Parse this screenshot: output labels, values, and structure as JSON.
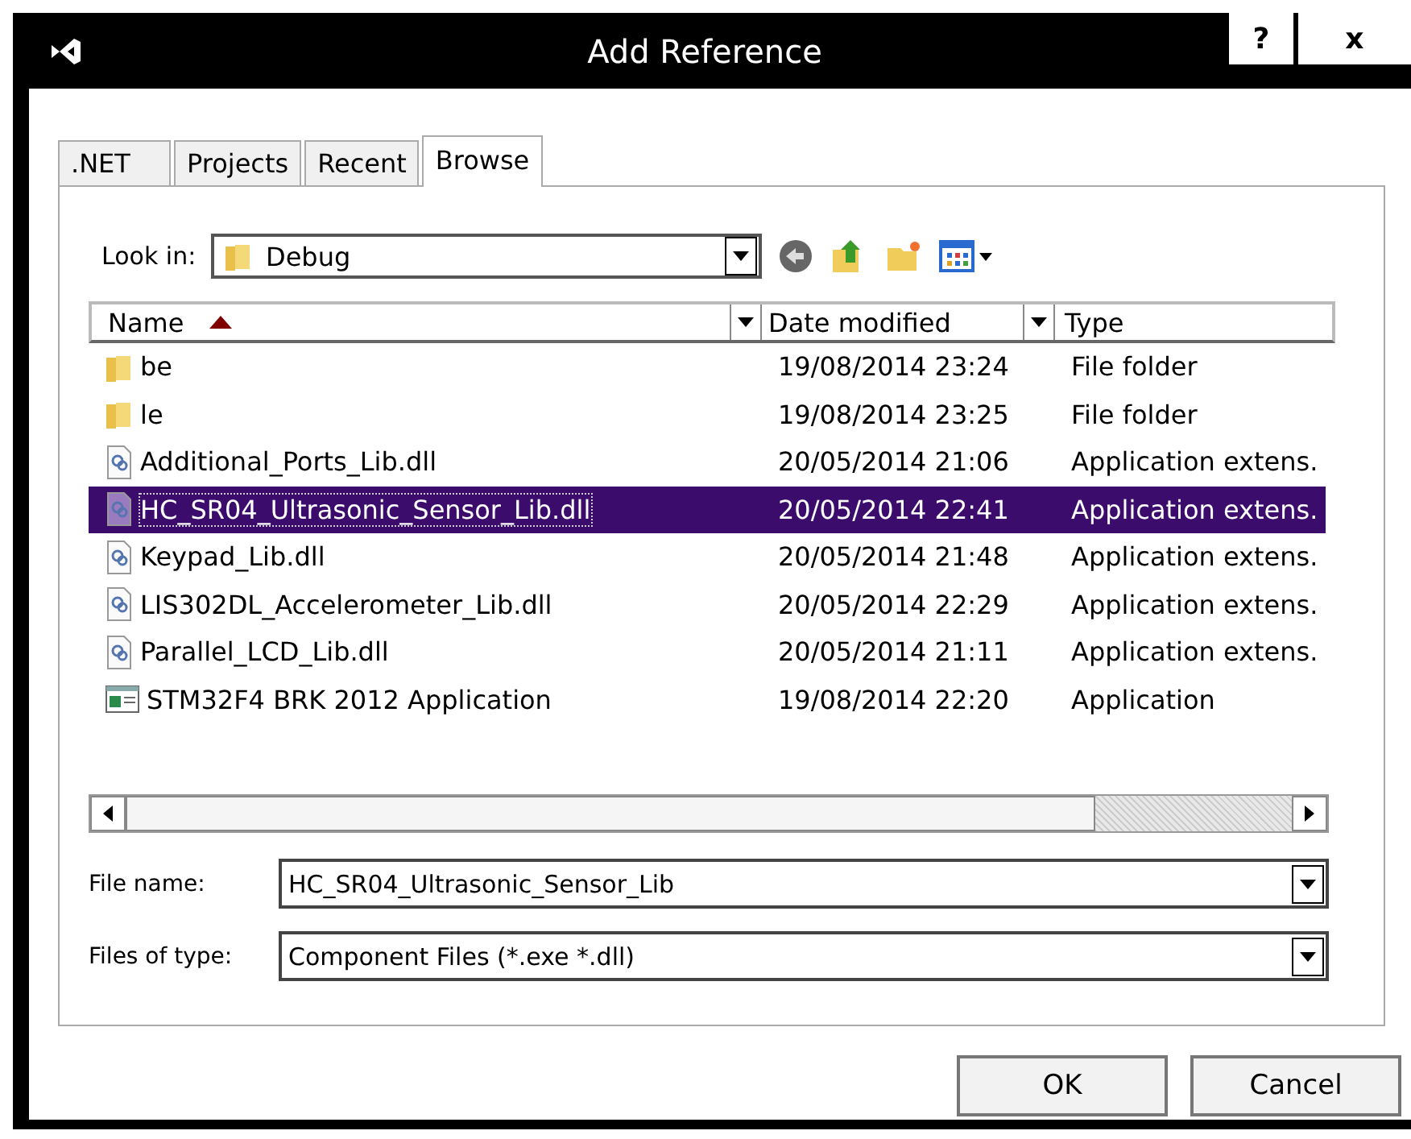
{
  "window": {
    "title": "Add Reference"
  },
  "title_buttons": [
    "?",
    "x"
  ],
  "tabs": [
    {
      "label": ".NET",
      "selected": false
    },
    {
      "label": "Projects",
      "selected": false
    },
    {
      "label": "Recent",
      "selected": false
    },
    {
      "label": "Browse",
      "selected": true
    }
  ],
  "look_in": {
    "label": "Look in:",
    "value": "Debug"
  },
  "columns": [
    {
      "label": "Name",
      "sorted": true
    },
    {
      "label": "Date modified",
      "sorted": false
    },
    {
      "label": "Type",
      "sorted": false
    }
  ],
  "rows": [
    {
      "kind": "folder",
      "name": "be",
      "date": "19/08/2014 23:24",
      "type": "File folder",
      "selected": false
    },
    {
      "kind": "folder",
      "name": "le",
      "date": "19/08/2014 23:25",
      "type": "File folder",
      "selected": false
    },
    {
      "kind": "dll",
      "name": "Additional_Ports_Lib.dll",
      "date": "20/05/2014 21:06",
      "type": "Application extens.",
      "selected": false
    },
    {
      "kind": "dll",
      "name": "HC_SR04_Ultrasonic_Sensor_Lib.dll",
      "date": "20/05/2014 22:41",
      "type": "Application extens.",
      "selected": true
    },
    {
      "kind": "dll",
      "name": "Keypad_Lib.dll",
      "date": "20/05/2014 21:48",
      "type": "Application extens.",
      "selected": false
    },
    {
      "kind": "dll",
      "name": "LIS302DL_Accelerometer_Lib.dll",
      "date": "20/05/2014 22:29",
      "type": "Application extens.",
      "selected": false
    },
    {
      "kind": "dll",
      "name": "Parallel_LCD_Lib.dll",
      "date": "20/05/2014 21:11",
      "type": "Application extens.",
      "selected": false
    },
    {
      "kind": "app",
      "name": "STM32F4 BRK 2012 Application",
      "date": "19/08/2014 22:20",
      "type": "Application",
      "selected": false
    }
  ],
  "file_name": {
    "label": "File name:",
    "value": "HC_SR04_Ultrasonic_Sensor_Lib"
  },
  "files_of_type": {
    "label": "Files of type:",
    "value": "Component Files (*.exe *.dll)"
  },
  "buttons": [
    "OK",
    "Cancel"
  ]
}
